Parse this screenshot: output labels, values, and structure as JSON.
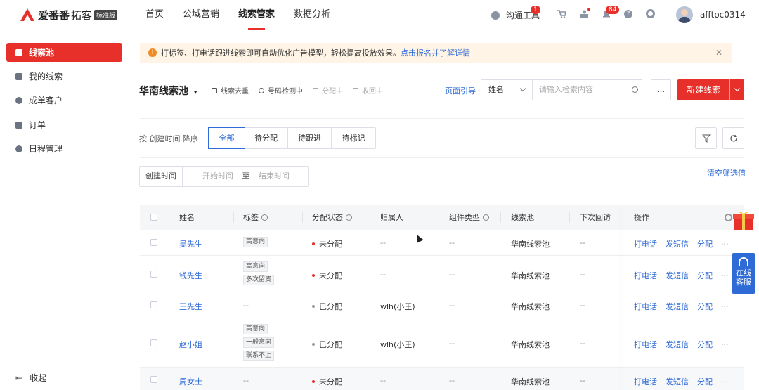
{
  "brand": {
    "name": "爱番番",
    "sub": "拓客",
    "edition": "标准版"
  },
  "nav": {
    "items": [
      "首页",
      "公域营销",
      "线索管家",
      "数据分析"
    ]
  },
  "topbar": {
    "chat_tool": "沟通工具",
    "chat_badge": "1",
    "notify_badge": "84",
    "username": "afftoc0314"
  },
  "sidebar": {
    "items": [
      {
        "label": "线索池",
        "icon": "leads-pool-icon"
      },
      {
        "label": "我的线索",
        "icon": "my-leads-icon"
      },
      {
        "label": "成单客户",
        "icon": "customer-icon"
      },
      {
        "label": "订单",
        "icon": "order-icon"
      },
      {
        "label": "日程管理",
        "icon": "calendar-icon"
      }
    ],
    "collapse": "收起"
  },
  "notice": {
    "text": "打标签、打电话跟进线索即可自动优化广告模型，轻松提高投放效果。",
    "link": "点击报名并了解详情",
    "close": "✕"
  },
  "toolbar": {
    "pool_title": "华南线索池",
    "actions": [
      "线索去重",
      "号码检测中",
      "分配中",
      "收回中"
    ],
    "guide": "页面引导",
    "search_field": "姓名",
    "search_placeholder": "请输入检索内容",
    "more": "...",
    "new_button": "新建线索"
  },
  "filter": {
    "sort_text": "按 创建时间 降序",
    "tabs": [
      "全部",
      "待分配",
      "待跟进",
      "待标记"
    ],
    "active_tab": "全部",
    "date_label": "创建时间",
    "date_start": "开始时间",
    "date_to": "至",
    "date_end": "结束时间",
    "clear": "清空筛选值"
  },
  "table": {
    "headers": [
      "姓名",
      "标签",
      "分配状态",
      "归属人",
      "组件类型",
      "线索池",
      "下次回访",
      "操作"
    ],
    "op_labels": [
      "打电话",
      "发短信",
      "分配",
      "···"
    ],
    "rows": [
      {
        "name": "吴先生",
        "tags": [
          "高意向"
        ],
        "status": "未分配",
        "status_color": "#e8302a",
        "owner": "--",
        "component": "--",
        "pool": "华南线索池",
        "next": "--"
      },
      {
        "name": "钱先生",
        "tags": [
          "高意向",
          "多次留资"
        ],
        "status": "未分配",
        "status_color": "#e8302a",
        "owner": "--",
        "component": "--",
        "pool": "华南线索池",
        "next": "--"
      },
      {
        "name": "王先生",
        "tags": [],
        "tag_empty": "--",
        "status": "已分配",
        "status_color": "#999999",
        "owner": "wlh(小王)",
        "component": "--",
        "pool": "华南线索池",
        "next": "--"
      },
      {
        "name": "赵小姐",
        "tags": [
          "高意向",
          "一般意向",
          "联系不上"
        ],
        "status": "已分配",
        "status_color": "#999999",
        "owner": "wlh(小王)",
        "component": "--",
        "pool": "华南线索池",
        "next": "--"
      },
      {
        "name": "周女士",
        "tags": [],
        "tag_empty": "--",
        "status": "未分配",
        "status_color": "#e8302a",
        "owner": "--",
        "component": "--",
        "pool": "华南线索池",
        "next": "--"
      }
    ]
  },
  "float": {
    "service": [
      "在线",
      "客服"
    ]
  },
  "colors": {
    "brand": "#e8302a",
    "link": "#2f6bd6",
    "warning": "#f08a24"
  }
}
